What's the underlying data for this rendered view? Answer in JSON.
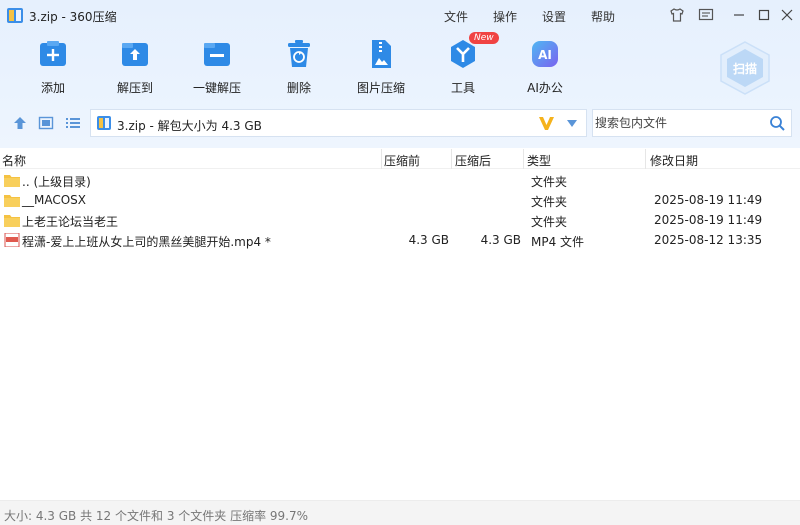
{
  "window": {
    "title": "3.zip - 360压缩"
  },
  "menu": [
    "文件",
    "操作",
    "设置",
    "帮助"
  ],
  "toolbar": [
    {
      "label": "添加",
      "icon": "add-icon"
    },
    {
      "label": "解压到",
      "icon": "extract-to-icon"
    },
    {
      "label": "一键解压",
      "icon": "one-click-extract-icon"
    },
    {
      "label": "删除",
      "icon": "delete-icon"
    },
    {
      "label": "图片压缩",
      "icon": "image-compress-icon"
    },
    {
      "label": "工具",
      "icon": "tools-icon",
      "badge": "New"
    },
    {
      "label": "AI办公",
      "icon": "ai-office-icon"
    }
  ],
  "scan": {
    "label": "扫描"
  },
  "address": {
    "path": "3.zip - 解包大小为 4.3 GB"
  },
  "search": {
    "placeholder": "搜索包内文件"
  },
  "columns": {
    "name": "名称",
    "compressed_before": "压缩前",
    "compressed_after": "压缩后",
    "type": "类型",
    "modified": "修改日期"
  },
  "files": [
    {
      "name": ".. (上级目录)",
      "before": "",
      "after": "",
      "type": "文件夹",
      "modified": "",
      "kind": "folder"
    },
    {
      "name": "__MACOSX",
      "before": "",
      "after": "",
      "type": "文件夹",
      "modified": "2025-08-19 11:49",
      "kind": "folder"
    },
    {
      "name": "上老王论坛当老王",
      "before": "",
      "after": "",
      "type": "文件夹",
      "modified": "2025-08-19 11:49",
      "kind": "folder"
    },
    {
      "name": "程潇-爱上上班从女上司的黑丝美腿开始.mp4 *",
      "before": "4.3 GB",
      "after": "4.3 GB",
      "type": "MP4 文件",
      "modified": "2025-08-12 13:35",
      "kind": "mp4"
    }
  ],
  "status": {
    "text": "大小: 4.3 GB 共 12 个文件和 3 个文件夹 压缩率 99.7%"
  },
  "colors": {
    "accent": "#2e8ae6",
    "ai_purple": "#7a63f0",
    "folder": "#f5c242",
    "badge_red": "#f04343"
  }
}
